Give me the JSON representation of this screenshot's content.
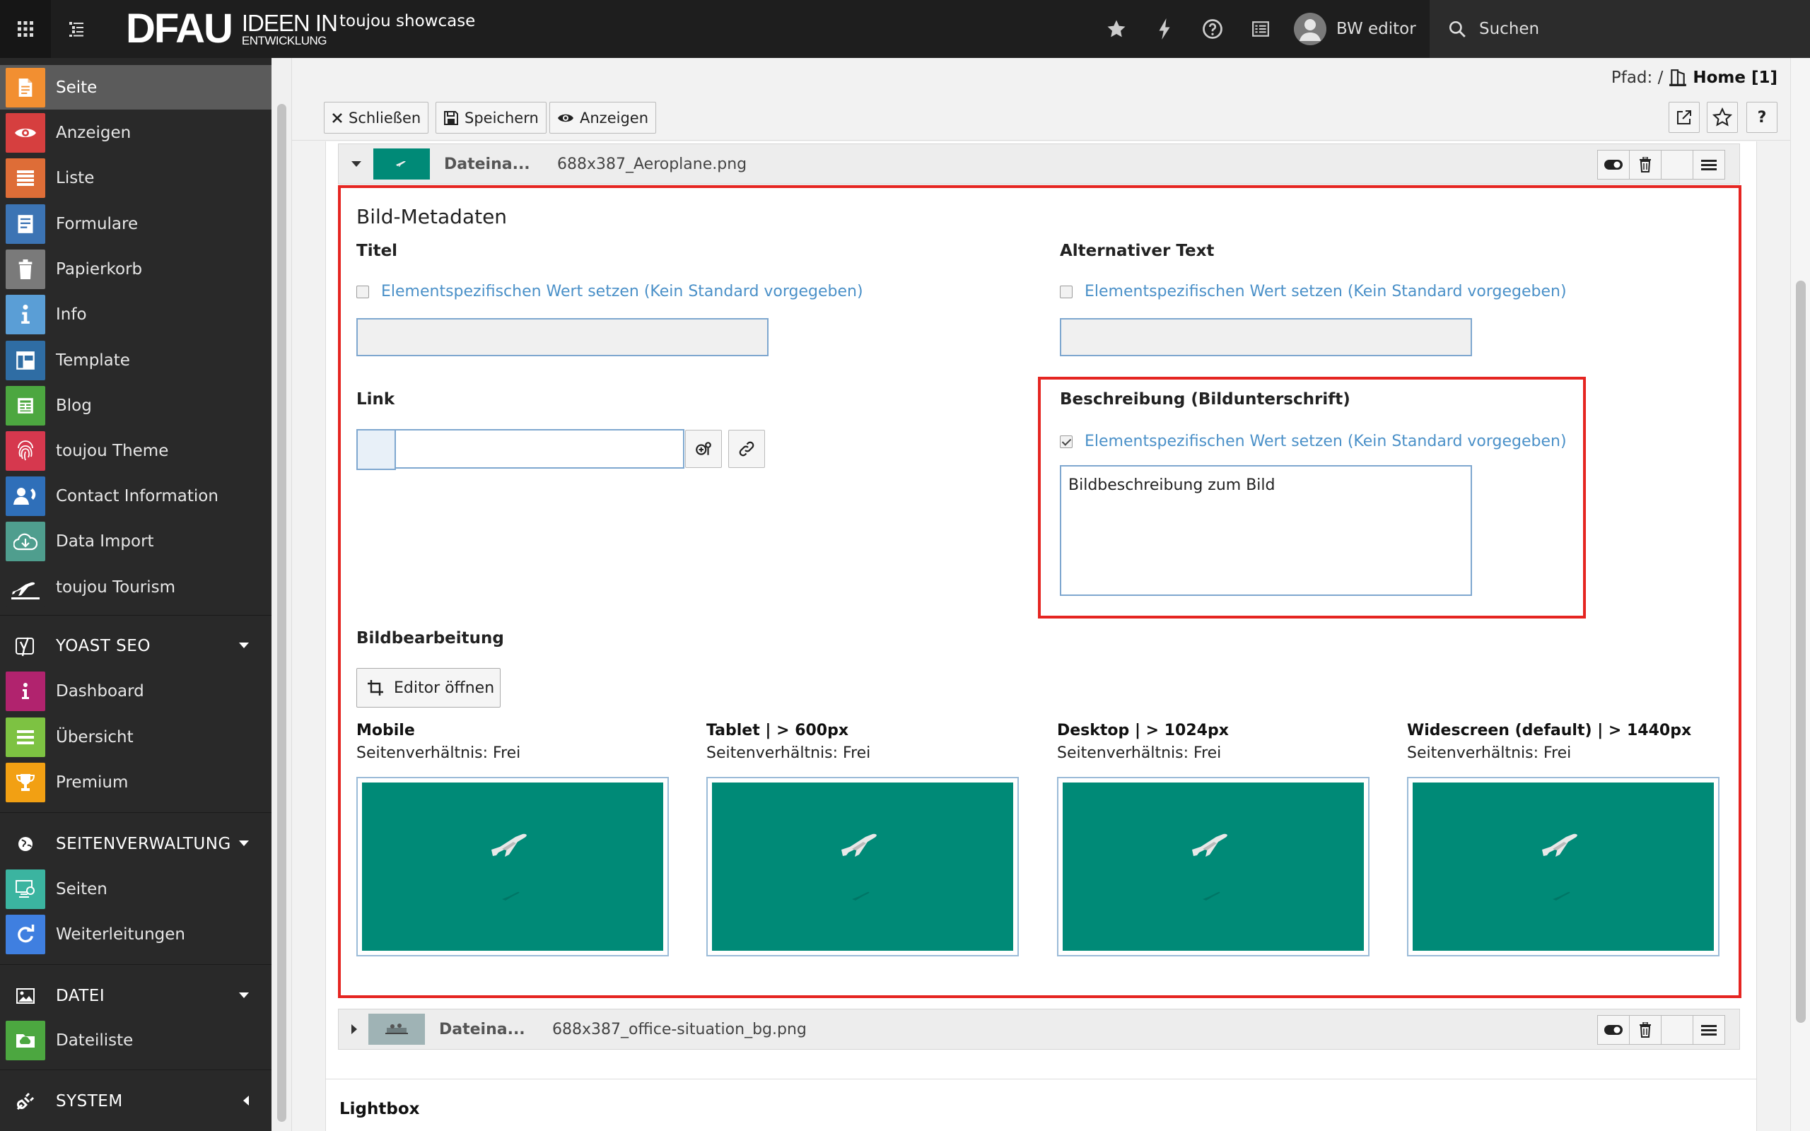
{
  "topbar": {
    "logo_main": "DFAU",
    "logo_sub_top": "IDEEN IN",
    "logo_sub_bottom": "ENTWICKLUNG",
    "site_name": "toujou showcase",
    "user_name": "BW editor",
    "search_label": "Suchen",
    "icons": [
      "apps-grid-icon",
      "page-tree-toggle-icon",
      "star-icon",
      "flash-icon",
      "help-icon",
      "list-icon",
      "user-avatar-icon",
      "search-icon"
    ]
  },
  "sidebar": {
    "modules": [
      {
        "label": "Seite",
        "icon": "page-icon",
        "color": "#f28f31",
        "active": true
      },
      {
        "label": "Anzeigen",
        "icon": "eye-icon",
        "color": "#d63f3f"
      },
      {
        "label": "Liste",
        "icon": "list-icon",
        "color": "#de6d37"
      },
      {
        "label": "Formulare",
        "icon": "form-icon",
        "color": "#3c74b4"
      },
      {
        "label": "Papierkorb",
        "icon": "trash-icon",
        "color": "#7a7a7a"
      },
      {
        "label": "Info",
        "icon": "info-icon",
        "color": "#5a9ed6"
      },
      {
        "label": "Template",
        "icon": "template-icon",
        "color": "#2f6da4"
      },
      {
        "label": "Blog",
        "icon": "blog-icon",
        "color": "#4ca740"
      },
      {
        "label": "toujou Theme",
        "icon": "fingerprint-icon",
        "color": "#d6384e"
      },
      {
        "label": "Contact Information",
        "icon": "contact-icon",
        "color": "#2f6fb9"
      },
      {
        "label": "Data Import",
        "icon": "cloud-download-icon",
        "color": "#4f9e8e"
      },
      {
        "label": "toujou Tourism",
        "icon": "plane-icon",
        "color": "#292929"
      }
    ],
    "groups": [
      {
        "label": "YOAST SEO",
        "icon": "yoast-icon",
        "items": [
          {
            "label": "Dashboard",
            "icon": "info-icon",
            "color": "#b1236e"
          },
          {
            "label": "Übersicht",
            "icon": "list-icon",
            "color": "#7dc242"
          },
          {
            "label": "Premium",
            "icon": "trophy-icon",
            "color": "#f2a013"
          }
        ]
      },
      {
        "label": "SEITENVERWALTUNG",
        "icon": "globe-icon",
        "items": [
          {
            "label": "Seiten",
            "icon": "sitemap-icon",
            "color": "#3bb4a0"
          },
          {
            "label": "Weiterleitungen",
            "icon": "redirect-icon",
            "color": "#3f7fe0"
          }
        ]
      },
      {
        "label": "DATEI",
        "icon": "image-icon",
        "items": [
          {
            "label": "Dateiliste",
            "icon": "folder-cloud-icon",
            "color": "#4ca740"
          }
        ]
      },
      {
        "label": "SYSTEM",
        "icon": "plug-icon",
        "items": []
      }
    ]
  },
  "docheader": {
    "path_label": "Pfad: /",
    "path_page": "Home [1]",
    "buttons": {
      "close": "Schließen",
      "save": "Speichern",
      "view": "Anzeigen"
    }
  },
  "file1": {
    "label": "Dateina...",
    "filename": "688x387_Aeroplane.png"
  },
  "file2": {
    "label": "Dateina...",
    "filename": "688x387_office-situation_bg.png"
  },
  "metadata": {
    "section_title": "Bild-Metadaten",
    "title_label": "Titel",
    "alt_label": "Alternativer Text",
    "link_label": "Link",
    "description_label": "Beschreibung (Bildunterschrift)",
    "override_text": "Elementspezifischen Wert setzen (Kein Standard vorgegeben)",
    "title_override": false,
    "alt_override": false,
    "description_override": true,
    "title_value": "",
    "alt_value": "",
    "link_value": "",
    "description_value": "Bildbeschreibung zum Bild"
  },
  "editing": {
    "label": "Bildbearbeitung",
    "open_editor": "Editor öffnen",
    "variants": [
      {
        "name": "Mobile",
        "ratio": "Seitenverhältnis: Frei"
      },
      {
        "name": "Tablet | > 600px",
        "ratio": "Seitenverhältnis: Frei"
      },
      {
        "name": "Desktop | > 1024px",
        "ratio": "Seitenverhältnis: Frei"
      },
      {
        "name": "Widescreen (default) | > 1440px",
        "ratio": "Seitenverhältnis: Frei"
      }
    ]
  },
  "lightbox_label": "Lightbox",
  "colors": {
    "accent": "#e52521",
    "link": "#4a90c8",
    "preview_bg": "#008a77",
    "active_module": "#f28f31"
  }
}
